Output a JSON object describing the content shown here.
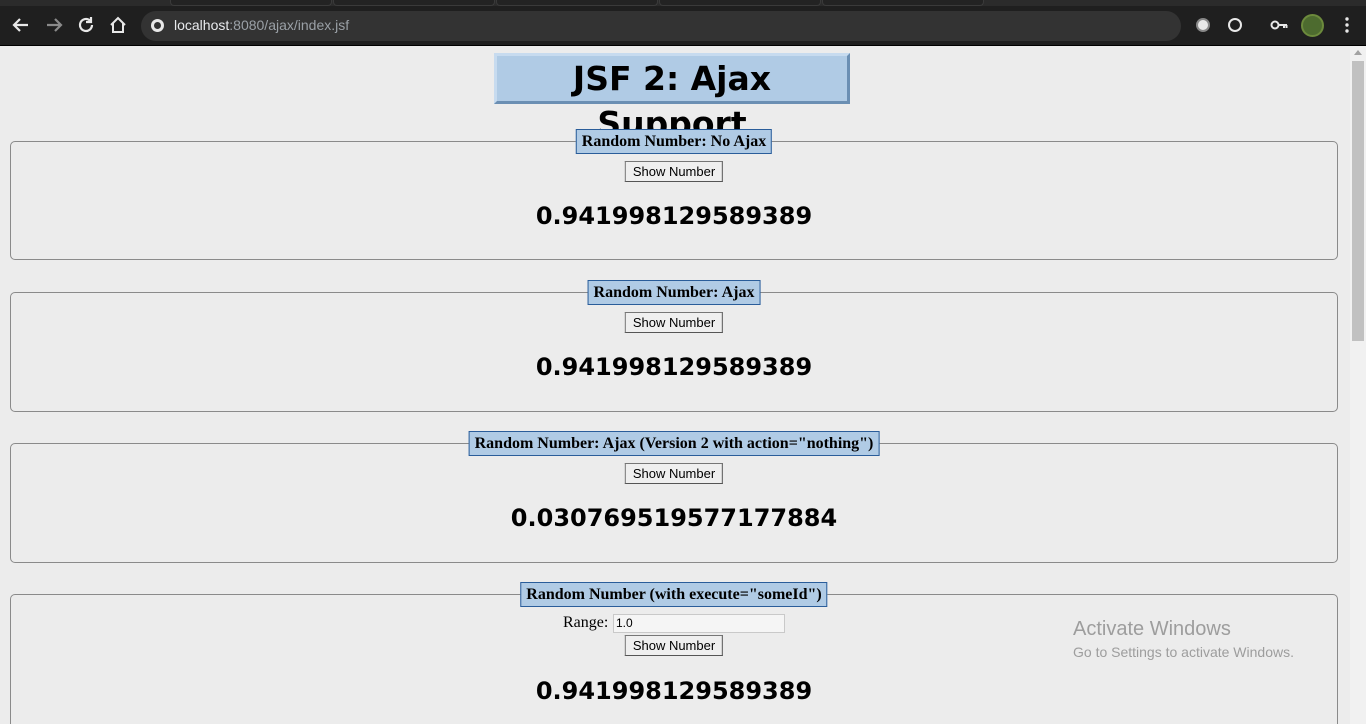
{
  "browser": {
    "url_host": "localhost",
    "url_rest": ":8080/ajax/index.jsf"
  },
  "page": {
    "title": "JSF 2: Ajax Support"
  },
  "panels": [
    {
      "legend": "Random Number: No Ajax",
      "button_label": "Show Number",
      "value": "0.941998129589389"
    },
    {
      "legend": "Random Number: Ajax",
      "button_label": "Show Number",
      "value": "0.941998129589389"
    },
    {
      "legend": "Random Number: Ajax (Version 2 with action=\"nothing\")",
      "button_label": "Show Number",
      "value": "0.030769519577177884"
    },
    {
      "legend": "Random Number (with execute=\"someId\")",
      "range_label": "Range:",
      "range_value": "1.0",
      "button_label": "Show Number",
      "value": "0.941998129589389"
    }
  ],
  "watermark": {
    "line1": "Activate Windows",
    "line2": "Go to Settings to activate Windows."
  },
  "colors": {
    "legend_bg": "#b0cbe5",
    "page_bg": "#ececec"
  }
}
